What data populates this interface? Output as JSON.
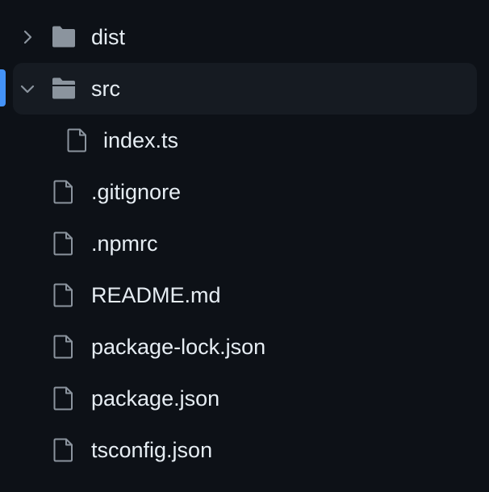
{
  "file_tree": {
    "items": [
      {
        "label": "dist",
        "type": "folder",
        "expanded": false,
        "icon": "folder-icon",
        "selected": false
      },
      {
        "label": "src",
        "type": "folder",
        "expanded": true,
        "icon": "folder-open-icon",
        "selected": true
      },
      {
        "label": "index.ts",
        "type": "file",
        "icon": "file-icon"
      },
      {
        "label": ".gitignore",
        "type": "file",
        "icon": "file-icon"
      },
      {
        "label": ".npmrc",
        "type": "file",
        "icon": "file-icon"
      },
      {
        "label": "README.md",
        "type": "file",
        "icon": "file-icon"
      },
      {
        "label": "package-lock.json",
        "type": "file",
        "icon": "file-icon"
      },
      {
        "label": "package.json",
        "type": "file",
        "icon": "file-icon"
      },
      {
        "label": "tsconfig.json",
        "type": "file",
        "icon": "file-icon"
      }
    ]
  },
  "colors": {
    "background": "#0d1117",
    "selected_row": "#161b22",
    "active_indicator": "#4493f8",
    "text": "#e6edf3",
    "icon": "#8b949e"
  }
}
